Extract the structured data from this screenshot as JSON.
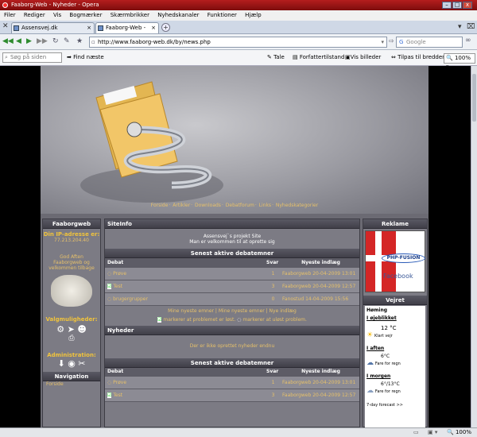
{
  "window": {
    "title": "Faaborg-Web - Nyheder - Opera",
    "min": "–",
    "max": "□",
    "close": "x"
  },
  "menu": [
    "Filer",
    "Rediger",
    "Vis",
    "Bogmærker",
    "Skærmbrikker",
    "Nyhedskanaler",
    "Funktioner",
    "Hjælp"
  ],
  "tabs": [
    {
      "label": "Assensvej.dk"
    },
    {
      "label": "Faaborg-Web - Nyheder"
    }
  ],
  "address": {
    "url": "http://www.faaborg-web.dk/by/news.php"
  },
  "search": {
    "placeholder": "Google"
  },
  "findbar": {
    "placeholder": "Søg på siden",
    "find_next": "Find næste",
    "tale": "Tale",
    "forfatter": "Forfattertilstand",
    "vis_billeder": "Vis billeder",
    "tilpas": "Tilpas til bredden",
    "zoom": "100%"
  },
  "banner": {
    "links": [
      "Forside",
      "Artikler",
      "Downloads",
      "Debatforum",
      "Links",
      "Nyhedskategorier"
    ]
  },
  "left": {
    "title": "Faaborgweb",
    "ip_label": "Din IP-adresse er:",
    "ip": "77.213.204.40",
    "greeting": "God Aften Faaborgweb og velkommen tilbage",
    "valg_label": "Valgmuligheder:",
    "admin_label": "Administration:",
    "nav_title": "Navigation",
    "nav_first": "Forside"
  },
  "siteinfo": {
    "title": "SiteInfo",
    "line1": "Assensvej`s projekt Site",
    "line2": "Man er velkommen til at oprette sig"
  },
  "debat": {
    "title": "Senest aktive debatemner",
    "cols": [
      "Debat",
      "Svar",
      "Nyeste indlæg"
    ],
    "rows": [
      {
        "name": "Prøve",
        "svar": "1",
        "user": "Faaborgweb",
        "date": "20-04-2009 13:01"
      },
      {
        "name": "Test",
        "svar": "3",
        "user": "Faaborgweb",
        "date": "20-04-2009 12:57"
      },
      {
        "name": "brugergrupper",
        "svar": "0",
        "user": "Fanostud",
        "date": "14-04-2009 15:56"
      }
    ],
    "links": "Mine nyeste emner | Mine nyeste emner | Nye indlæg",
    "legend1": "markerer at problemet er løst.",
    "legend2": "markerer at uløst problem."
  },
  "nyheder": {
    "title": "Nyheder",
    "empty": "Der er ikke oprettet nyheder endnu"
  },
  "debat2": {
    "title": "Senest aktive debatemner",
    "cols": [
      "Debat",
      "Svar",
      "Nyeste indlæg"
    ],
    "rows": [
      {
        "name": "Prøve",
        "svar": "1",
        "user": "Faaborgweb",
        "date": "20-04-2009 13:01"
      },
      {
        "name": "Test",
        "svar": "3",
        "user": "Faaborgweb",
        "date": "20-04-2009 12:57"
      }
    ]
  },
  "right": {
    "reklame": "Reklame",
    "php": "PHP-FUSION",
    "facebook": "Facebook",
    "vejret": "Vejret",
    "city": "Høming",
    "now_label": "I øjeblikket",
    "now_temp": "12 °C",
    "now_desc": "Klart vejr",
    "evening_label": "I aften",
    "evening_temp": "6°C",
    "evening_desc": "Fare for regn",
    "morning_label": "I morgen",
    "morning_temp": "6°/13°C",
    "morning_desc": "Fare for regn",
    "forecast": "7-day forecast >>"
  },
  "status": {
    "zoom": "100%"
  }
}
